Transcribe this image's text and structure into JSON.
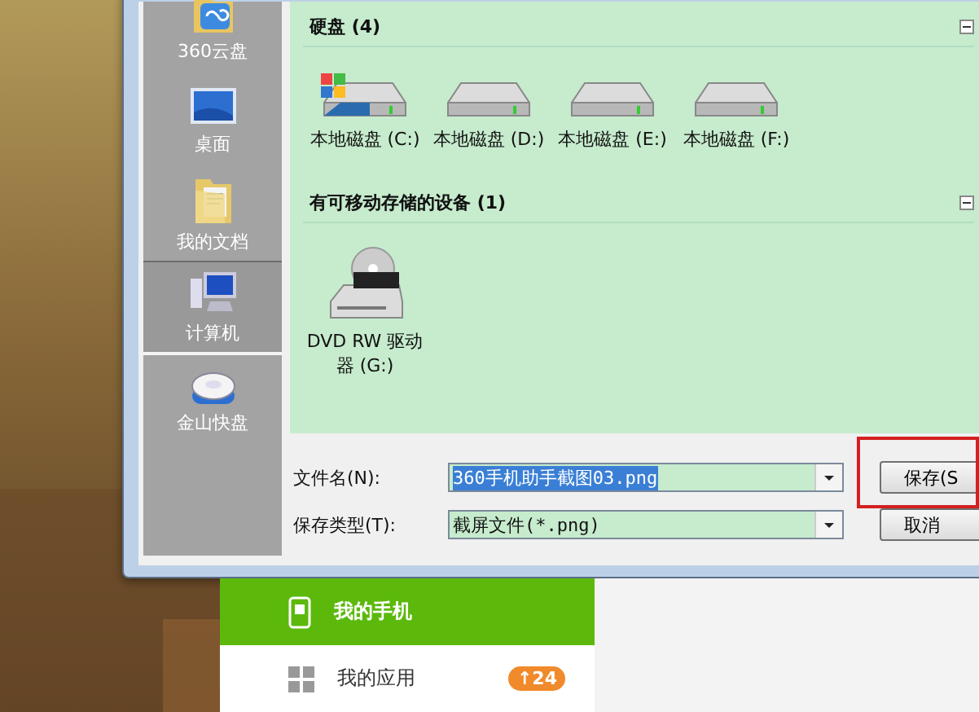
{
  "sidebar": {
    "items": [
      {
        "label": "360云盘",
        "kind": "cloud-folder",
        "selected": false
      },
      {
        "label": "桌面",
        "kind": "desktop",
        "selected": false
      },
      {
        "label": "我的文档",
        "kind": "documents",
        "selected": false
      },
      {
        "label": "计算机",
        "kind": "computer",
        "selected": true
      },
      {
        "label": "金山快盘",
        "kind": "drive",
        "selected": false
      }
    ]
  },
  "content": {
    "groups": [
      {
        "title": "硬盘 (4)",
        "items": [
          {
            "label": "本地磁盘 (C:)",
            "kind": "system-drive"
          },
          {
            "label": "本地磁盘 (D:)",
            "kind": "drive"
          },
          {
            "label": "本地磁盘 (E:)",
            "kind": "drive"
          },
          {
            "label": "本地磁盘 (F:)",
            "kind": "drive"
          }
        ]
      },
      {
        "title": "有可移动存储的设备 (1)",
        "items": [
          {
            "label": "DVD RW 驱动器 (G:)",
            "kind": "dvd"
          }
        ]
      }
    ]
  },
  "form": {
    "fields": [
      {
        "label": "文件名(N):",
        "value": "360手机助手截图03.png",
        "selected": true
      },
      {
        "label": "保存类型(T):",
        "value": "截屏文件(*.png)",
        "selected": false
      }
    ],
    "buttons": [
      {
        "label": "保存(S",
        "highlighted": true
      },
      {
        "label": "取消",
        "highlighted": false
      }
    ]
  },
  "app_nav": {
    "items": [
      {
        "label": "我的手机",
        "kind": "phone",
        "selected": true
      },
      {
        "label": "我的应用",
        "kind": "apps",
        "selected": false,
        "badge": "↑24"
      }
    ]
  }
}
